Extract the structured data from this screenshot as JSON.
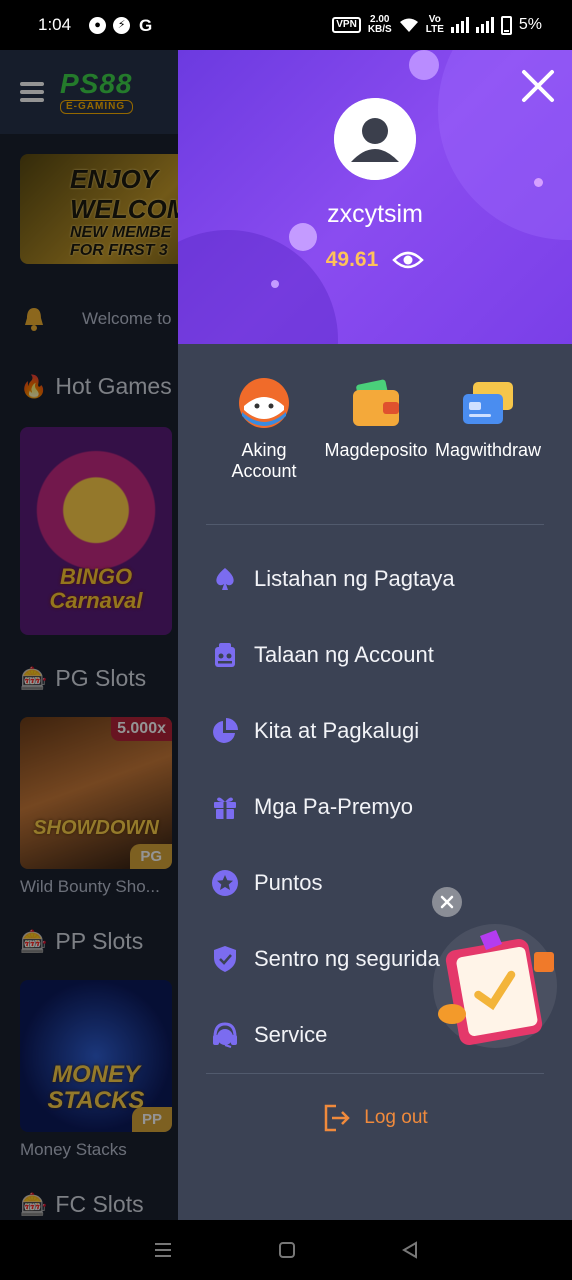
{
  "status_bar": {
    "time": "1:04",
    "notification_icons": [
      "chat-icon",
      "messenger-icon",
      "g-icon"
    ],
    "vpn": "VPN",
    "net_speed_value": "2.00",
    "net_speed_unit": "KB/S",
    "volte_top": "Vo",
    "volte_bottom": "LTE",
    "battery": "5%"
  },
  "app": {
    "logo_main": "PS88",
    "logo_sub": "E-GAMING",
    "banner_line1": "ENJOY",
    "banner_line2": "WELCOM",
    "banner_line3": "NEW MEMBE",
    "banner_line4": "FOR FIRST 3",
    "notice_text": "Welcome to",
    "sections": {
      "hot_games": "Hot Games",
      "pg_slots": "PG Slots",
      "pp_slots": "PP Slots",
      "fc_slots": "FC Slots"
    },
    "games": {
      "bingo_title": "BINGO\nCarnaval",
      "bounty_multiplier": "5.000x",
      "bounty_tag": "PG",
      "bounty_art": "SHOWDOWN",
      "bounty_caption": "Wild Bounty Sho...",
      "money_art": "MONEY\nSTACKS",
      "money_tag": "PP",
      "money_caption": "Money Stacks"
    }
  },
  "drawer": {
    "username": "zxcytsim",
    "balance": "49.61",
    "quick_actions": [
      {
        "label": "Aking\nAccount",
        "icon": "seal-avatar-icon"
      },
      {
        "label": "Magdeposito",
        "icon": "wallet-icon"
      },
      {
        "label": "Magwithdraw",
        "icon": "cards-icon"
      }
    ],
    "menu": [
      {
        "label": "Listahan ng Pagtaya",
        "icon": "spade-icon"
      },
      {
        "label": "Talaan ng Account",
        "icon": "account-record-icon"
      },
      {
        "label": "Kita at Pagkalugi",
        "icon": "pie-chart-icon"
      },
      {
        "label": "Mga Pa-Premyo",
        "icon": "gift-icon"
      },
      {
        "label": "Puntos",
        "icon": "star-icon"
      },
      {
        "label": "Sentro ng segurida",
        "icon": "shield-icon"
      },
      {
        "label": "Service",
        "icon": "headset-icon"
      }
    ],
    "logout": "Log out"
  },
  "colors": {
    "drawer_header": "#7a3fe8",
    "drawer_body": "#3b4254",
    "balance": "#ffc25a",
    "menu_icon": "#7b6cf0",
    "logout": "#f08a3c"
  }
}
